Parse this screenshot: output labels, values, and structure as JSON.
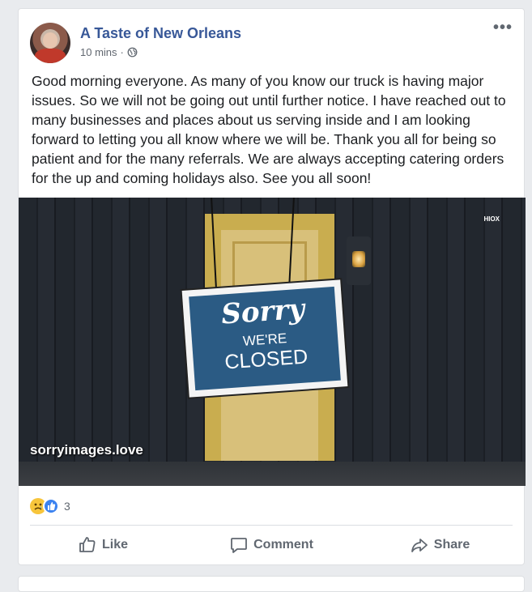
{
  "post": {
    "page_name": "A Taste of New Orleans",
    "time": "10 mins",
    "separator": "·",
    "more": "•••",
    "text": "Good morning everyone. As many of you know our truck is having major issues. So we will not be going out until further notice. I have reached out to many businesses and places about us serving inside and I am looking forward to letting you all know where we will be. Thank you all for being so patient and for the many referrals. We are always accepting catering orders for the up and coming holidays also. See you all soon!"
  },
  "image": {
    "sign_line1": "Sorry",
    "sign_line2": "WE'RE",
    "sign_line3": "CLOSED",
    "corner_mark": "HIOX",
    "watermark": "sorryimages.love"
  },
  "reactions": {
    "icons": [
      "sad-reaction-icon",
      "like-reaction-icon"
    ],
    "count": "3"
  },
  "actions": {
    "like": "Like",
    "comment": "Comment",
    "share": "Share"
  },
  "colors": {
    "page_name": "#385898",
    "action_text": "#606770",
    "sign_blue": "#2b5b84",
    "background": "#e9ebee"
  }
}
